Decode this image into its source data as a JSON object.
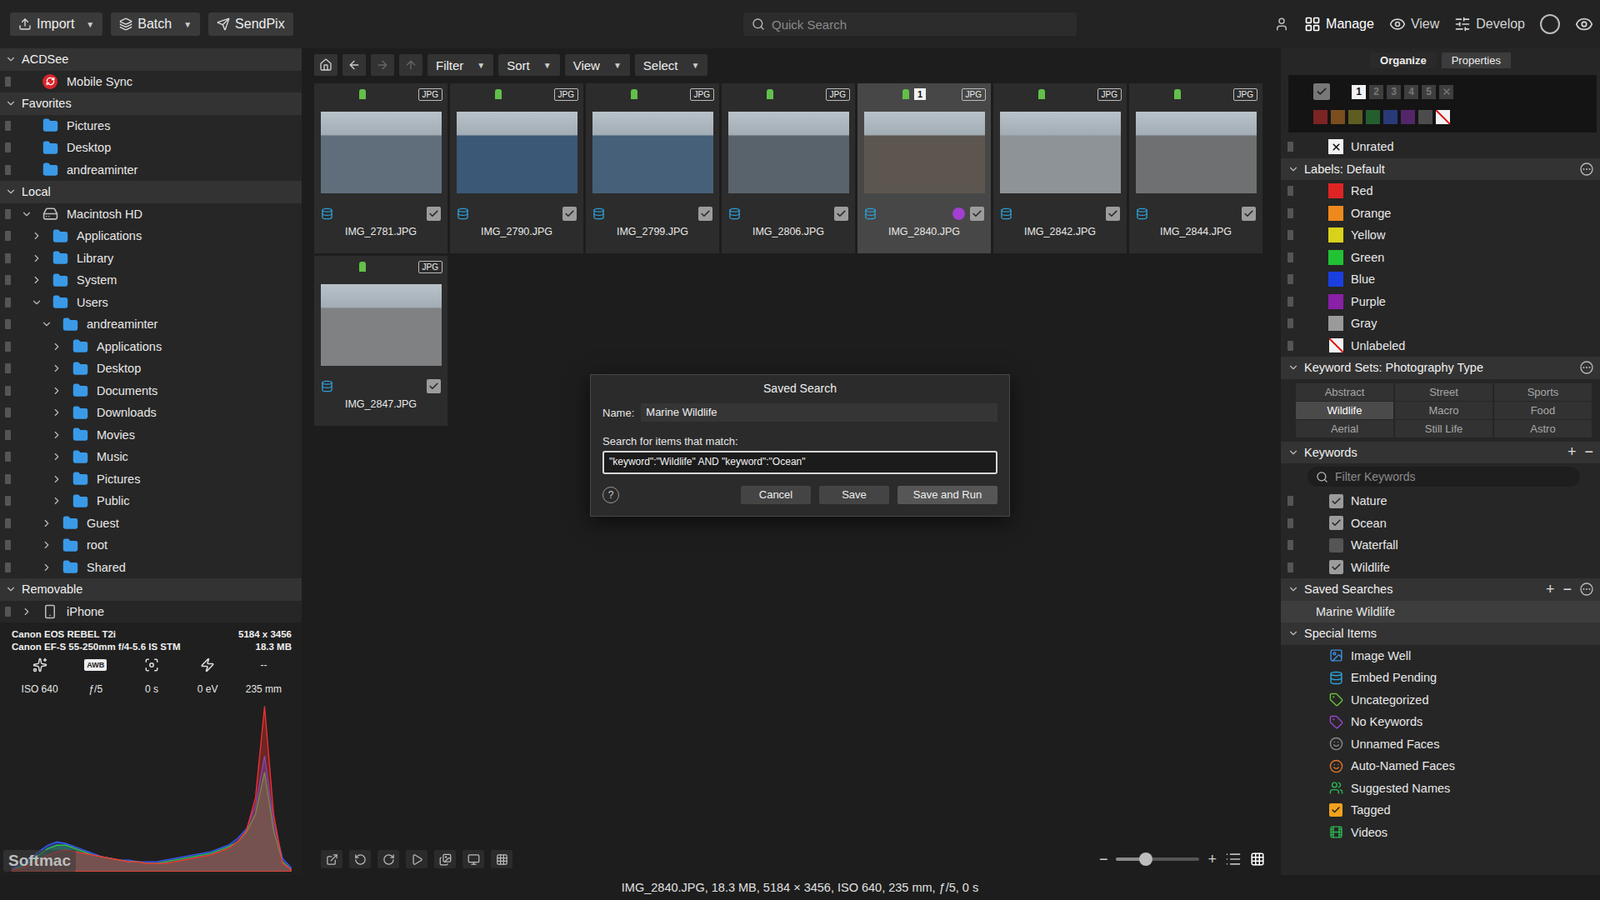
{
  "toolbar": {
    "buttons": [
      {
        "label": "Import",
        "dropdown": true
      },
      {
        "label": "Batch",
        "dropdown": true
      },
      {
        "label": "SendPix",
        "dropdown": false
      }
    ],
    "arrow": "▼",
    "search_placeholder": "Quick Search",
    "modes": [
      {
        "label": "Manage",
        "selected": true
      },
      {
        "label": "View",
        "selected": false
      },
      {
        "label": "Develop",
        "selected": false
      }
    ]
  },
  "sidebar": {
    "rows": [
      {
        "kind": "header",
        "label": "ACDSee",
        "expanded": true
      },
      {
        "kind": "sync",
        "label": "Mobile Sync",
        "depth": 0,
        "expandable": false
      },
      {
        "kind": "header",
        "label": "Favorites",
        "expanded": true
      },
      {
        "kind": "folder",
        "label": "Pictures",
        "depth": 0,
        "expandable": false
      },
      {
        "kind": "folder",
        "label": "Desktop",
        "depth": 0,
        "expandable": false
      },
      {
        "kind": "folder",
        "label": "andreaminter",
        "depth": 0,
        "expandable": false
      },
      {
        "kind": "header",
        "label": "Local",
        "expanded": true
      },
      {
        "kind": "drive",
        "label": "Macintosh HD",
        "depth": 0,
        "expandable": true,
        "expanded": true
      },
      {
        "kind": "folder",
        "label": "Applications",
        "depth": 1,
        "expandable": true,
        "expanded": false
      },
      {
        "kind": "folder",
        "label": "Library",
        "depth": 1,
        "expandable": true,
        "expanded": false
      },
      {
        "kind": "folder",
        "label": "System",
        "depth": 1,
        "expandable": true,
        "expanded": false
      },
      {
        "kind": "folder",
        "label": "Users",
        "depth": 1,
        "expandable": true,
        "expanded": true
      },
      {
        "kind": "folder",
        "label": "andreaminter",
        "depth": 2,
        "expandable": true,
        "expanded": true
      },
      {
        "kind": "folder",
        "label": "Applications",
        "depth": 3,
        "expandable": true,
        "expanded": false
      },
      {
        "kind": "folder",
        "label": "Desktop",
        "depth": 3,
        "expandable": true,
        "expanded": false
      },
      {
        "kind": "folder",
        "label": "Documents",
        "depth": 3,
        "expandable": true,
        "expanded": false
      },
      {
        "kind": "folder",
        "label": "Downloads",
        "depth": 3,
        "expandable": true,
        "expanded": false
      },
      {
        "kind": "folder",
        "label": "Movies",
        "depth": 3,
        "expandable": true,
        "expanded": false
      },
      {
        "kind": "folder",
        "label": "Music",
        "depth": 3,
        "expandable": true,
        "expanded": false
      },
      {
        "kind": "folder",
        "label": "Pictures",
        "depth": 3,
        "expandable": true,
        "expanded": false
      },
      {
        "kind": "folder",
        "label": "Public",
        "depth": 3,
        "expandable": true,
        "expanded": false
      },
      {
        "kind": "folder",
        "label": "Guest",
        "depth": 2,
        "expandable": true,
        "expanded": false
      },
      {
        "kind": "folder",
        "label": "root",
        "depth": 2,
        "expandable": true,
        "expanded": false
      },
      {
        "kind": "folder",
        "label": "Shared",
        "depth": 2,
        "expandable": true,
        "expanded": false
      },
      {
        "kind": "header",
        "label": "Removable",
        "expanded": true
      },
      {
        "kind": "phone",
        "label": "iPhone",
        "depth": 0,
        "expandable": true,
        "expanded": false
      }
    ]
  },
  "info": {
    "camera": "Canon EOS REBEL T2i",
    "dimensions": "5184 x 3456",
    "lens": "Canon EF-S 55-250mm f/4-5.6 IS STM",
    "size": "18.3 MB",
    "badges": [
      {
        "kind": "mode"
      },
      {
        "kind": "text",
        "label": "AWB"
      },
      {
        "kind": "metering"
      },
      {
        "kind": "flash"
      },
      {
        "kind": "plain",
        "label": "--"
      }
    ],
    "values": [
      "ISO 640",
      "ƒ/5",
      "0 s",
      "0 eV",
      "235 mm"
    ],
    "histogram": {
      "blue": [
        2,
        4,
        8,
        12,
        16,
        18,
        17,
        15,
        13,
        11,
        9,
        8,
        7,
        7,
        6,
        6,
        6,
        7,
        8,
        9,
        10,
        11,
        12,
        14,
        16,
        20,
        26,
        40,
        70,
        30,
        8,
        2
      ],
      "green": [
        1,
        3,
        6,
        10,
        14,
        16,
        16,
        14,
        12,
        10,
        9,
        8,
        7,
        6,
        6,
        5,
        5,
        6,
        7,
        8,
        9,
        10,
        11,
        13,
        15,
        18,
        24,
        35,
        60,
        25,
        6,
        1
      ],
      "red": [
        1,
        2,
        4,
        7,
        10,
        12,
        13,
        12,
        11,
        10,
        9,
        8,
        7,
        6,
        6,
        5,
        5,
        5,
        6,
        7,
        8,
        9,
        10,
        12,
        14,
        18,
        25,
        45,
        100,
        35,
        5,
        1
      ]
    }
  },
  "watermark": "Softmac",
  "browser": {
    "nav": [
      {
        "kind": "home",
        "disabled": false
      },
      {
        "kind": "back",
        "disabled": false
      },
      {
        "kind": "forward",
        "disabled": true
      },
      {
        "kind": "up",
        "disabled": true
      }
    ],
    "menus": [
      "Filter",
      "Sort",
      "View",
      "Select"
    ],
    "thumbnails": [
      {
        "file": "IMG_2781.JPG",
        "badge": "JPG",
        "selected": false,
        "checked": true,
        "color": "#5f6e7a"
      },
      {
        "file": "IMG_2790.JPG",
        "badge": "JPG",
        "selected": false,
        "checked": true,
        "color": "#3b5877"
      },
      {
        "file": "IMG_2799.JPG",
        "badge": "JPG",
        "selected": false,
        "checked": true,
        "color": "#466079"
      },
      {
        "file": "IMG_2806.JPG",
        "badge": "JPG",
        "selected": false,
        "checked": true,
        "color": "#59636c"
      },
      {
        "file": "IMG_2840.JPG",
        "badge": "JPG",
        "selected": true,
        "checked": true,
        "color": "#5c564f",
        "number": "1",
        "label_color": "#a23fd0"
      },
      {
        "file": "IMG_2842.JPG",
        "badge": "JPG",
        "selected": false,
        "checked": true,
        "color": "#8d9397"
      },
      {
        "file": "IMG_2844.JPG",
        "badge": "JPG",
        "selected": false,
        "checked": true,
        "color": "#6e7072"
      },
      {
        "file": "IMG_2847.JPG",
        "badge": "JPG",
        "selected": false,
        "checked": true,
        "color": "#7f8182"
      }
    ]
  },
  "dialog": {
    "title": "Saved Search",
    "name_label": "Name:",
    "name_value": "Marine Wildlife",
    "query_label": "Search for items that match:",
    "query_value": "\"keyword\":\"Wildlife\" AND \"keyword\":\"Ocean\"",
    "help": "?",
    "buttons": [
      {
        "label": "Cancel",
        "primary": false
      },
      {
        "label": "Save",
        "primary": false
      },
      {
        "label": "Save and Run",
        "primary": true
      }
    ]
  },
  "bottom_bar": {
    "minus": "−",
    "plus": "+",
    "zoom_level": 0.36,
    "list_selected": false
  },
  "status_bar": "IMG_2840.JPG, 18.3 MB, 5184 × 3456, ISO 640, 235 mm, ƒ/5, 0 s",
  "right_panel": {
    "tabs": [
      {
        "label": "Organize",
        "selected": true
      },
      {
        "label": "Properties",
        "selected": false
      }
    ],
    "rating_filter_checked": true,
    "ratings": [
      {
        "label": "1",
        "selected": true
      },
      {
        "label": "2",
        "selected": false
      },
      {
        "label": "3",
        "selected": false
      },
      {
        "label": "4",
        "selected": false
      },
      {
        "label": "5",
        "selected": false
      }
    ],
    "swatches": [
      {
        "kind": "color",
        "color": "#7c2424"
      },
      {
        "kind": "color",
        "color": "#7a4e1e"
      },
      {
        "kind": "color",
        "color": "#5d5d22"
      },
      {
        "kind": "color",
        "color": "#245e2e"
      },
      {
        "kind": "color",
        "color": "#283a78"
      },
      {
        "kind": "color",
        "color": "#522668"
      },
      {
        "kind": "color",
        "color": "#4c4c4c"
      },
      {
        "kind": "none"
      }
    ],
    "unrated": "Unrated",
    "labels": {
      "title": "Labels: Default",
      "expanded": true,
      "items": [
        {
          "label": "Red",
          "kind": "color",
          "color": "#e02424"
        },
        {
          "label": "Orange",
          "kind": "color",
          "color": "#ee8a1c"
        },
        {
          "label": "Yellow",
          "kind": "color",
          "color": "#d9d21a"
        },
        {
          "label": "Green",
          "kind": "color",
          "color": "#22c235"
        },
        {
          "label": "Blue",
          "kind": "color",
          "color": "#1a3fe0"
        },
        {
          "label": "Purple",
          "kind": "color",
          "color": "#8a1fa8"
        },
        {
          "label": "Gray",
          "kind": "color",
          "color": "#9a9a9a"
        },
        {
          "label": "Unlabeled",
          "kind": "none"
        }
      ]
    },
    "keyword_sets": {
      "title": "Keyword Sets: Photography Type",
      "expanded": true,
      "items": [
        {
          "label": "Abstract",
          "selected": false
        },
        {
          "label": "Street",
          "selected": false
        },
        {
          "label": "Sports",
          "selected": false
        },
        {
          "label": "Wildlife",
          "selected": true
        },
        {
          "label": "Macro",
          "selected": false
        },
        {
          "label": "Food",
          "selected": false
        },
        {
          "label": "Aerial",
          "selected": false
        },
        {
          "label": "Still Life",
          "selected": false
        },
        {
          "label": "Astro",
          "selected": false
        }
      ]
    },
    "keywords": {
      "title": "Keywords",
      "expanded": true,
      "add": "+",
      "remove": "−",
      "filter_placeholder": "Filter Keywords",
      "items": [
        {
          "label": "Nature",
          "checked": true
        },
        {
          "label": "Ocean",
          "checked": true
        },
        {
          "label": "Waterfall",
          "checked": false
        },
        {
          "label": "Wildlife",
          "checked": true
        }
      ]
    },
    "saved_searches": {
      "title": "Saved Searches",
      "expanded": true,
      "add": "+",
      "remove": "−",
      "items": [
        {
          "label": "Marine Wildlife",
          "selected": true
        }
      ]
    },
    "special_items": {
      "title": "Special Items",
      "expanded": true,
      "items": [
        {
          "label": "Image Well",
          "kind": "well",
          "color": "#3d8fe0"
        },
        {
          "label": "Embed Pending",
          "kind": "pending",
          "color": "#2f9fd8"
        },
        {
          "label": "Uncategorized",
          "kind": "uncategorized",
          "color": "#6cc03a"
        },
        {
          "label": "No Keywords",
          "kind": "nokeywords",
          "color": "#9a46c8"
        },
        {
          "label": "Unnamed Faces",
          "kind": "faces",
          "color": "#8a8a8a"
        },
        {
          "label": "Auto-Named Faces",
          "kind": "autofaces",
          "color": "#e0762a"
        },
        {
          "label": "Suggested Names",
          "kind": "suggested",
          "color": "#2fb450"
        },
        {
          "label": "Tagged",
          "kind": "tagged",
          "color": "#f0a21e"
        },
        {
          "label": "Videos",
          "kind": "videos",
          "color": "#2fb450"
        }
      ]
    }
  }
}
